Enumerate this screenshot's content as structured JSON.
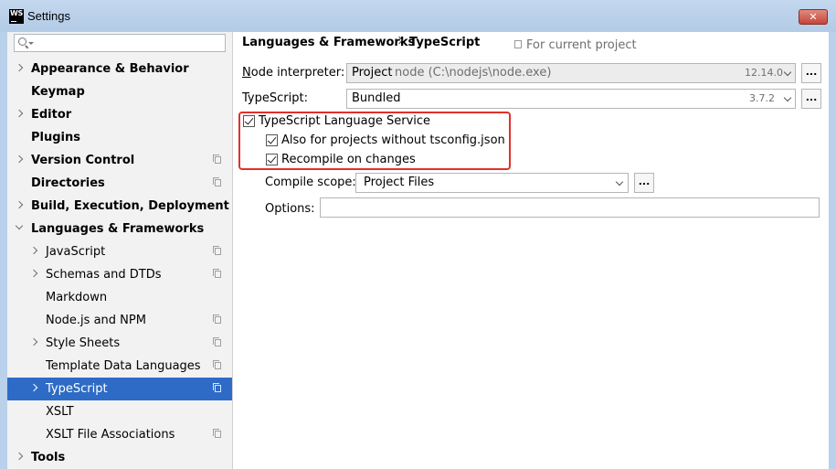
{
  "window": {
    "title": "Settings",
    "app_badge": "WS",
    "close_glyph": "✕"
  },
  "sidebar": {
    "search_placeholder": "",
    "items": [
      {
        "label": "Appearance & Behavior",
        "bold": true,
        "expander": "collapsed",
        "level": 0,
        "scope_icon": false
      },
      {
        "label": "Keymap",
        "bold": true,
        "expander": "none",
        "level": 0,
        "scope_icon": false
      },
      {
        "label": "Editor",
        "bold": true,
        "expander": "collapsed",
        "level": 0,
        "scope_icon": false
      },
      {
        "label": "Plugins",
        "bold": true,
        "expander": "none",
        "level": 0,
        "scope_icon": false
      },
      {
        "label": "Version Control",
        "bold": true,
        "expander": "collapsed",
        "level": 0,
        "scope_icon": true
      },
      {
        "label": "Directories",
        "bold": true,
        "expander": "none",
        "level": 0,
        "scope_icon": true
      },
      {
        "label": "Build, Execution, Deployment",
        "bold": true,
        "expander": "collapsed",
        "level": 0,
        "scope_icon": false
      },
      {
        "label": "Languages & Frameworks",
        "bold": true,
        "expander": "expanded",
        "level": 0,
        "scope_icon": false
      },
      {
        "label": "JavaScript",
        "bold": false,
        "expander": "collapsed",
        "level": 1,
        "scope_icon": true
      },
      {
        "label": "Schemas and DTDs",
        "bold": false,
        "expander": "collapsed",
        "level": 1,
        "scope_icon": true
      },
      {
        "label": "Markdown",
        "bold": false,
        "expander": "none",
        "level": 1,
        "scope_icon": false
      },
      {
        "label": "Node.js and NPM",
        "bold": false,
        "expander": "none",
        "level": 1,
        "scope_icon": true
      },
      {
        "label": "Style Sheets",
        "bold": false,
        "expander": "collapsed",
        "level": 1,
        "scope_icon": true
      },
      {
        "label": "Template Data Languages",
        "bold": false,
        "expander": "none",
        "level": 1,
        "scope_icon": true
      },
      {
        "label": "TypeScript",
        "bold": false,
        "expander": "collapsed",
        "level": 1,
        "scope_icon": true,
        "selected": true
      },
      {
        "label": "XSLT",
        "bold": false,
        "expander": "none",
        "level": 1,
        "scope_icon": false
      },
      {
        "label": "XSLT File Associations",
        "bold": false,
        "expander": "none",
        "level": 1,
        "scope_icon": true
      },
      {
        "label": "Tools",
        "bold": true,
        "expander": "collapsed",
        "level": 0,
        "scope_icon": false
      }
    ]
  },
  "breadcrumb": {
    "parent": "Languages & Frameworks",
    "current": "TypeScript",
    "scope_note": "For current project"
  },
  "node_interpreter": {
    "label": "Node interpreter:",
    "mnemonic": "N",
    "label_rest": "ode interpreter:",
    "kind": "Project",
    "path": "node (C:\\nodejs\\node.exe)",
    "version": "12.14.0",
    "browse": "..."
  },
  "typescript": {
    "label": "TypeScript:",
    "value": "Bundled",
    "version": "3.7.2",
    "browse": "..."
  },
  "language_service": {
    "label": "TypeScript Language Service",
    "checked": true,
    "without_tsconfig": {
      "label": "Also for projects without tsconfig.json",
      "checked": true
    },
    "recompile": {
      "label": "Recompile on changes",
      "checked": true
    }
  },
  "compile_scope": {
    "label": "Compile scope:",
    "value": "Project Files",
    "browse": "..."
  },
  "options": {
    "label": "Options:",
    "value": ""
  },
  "colors": {
    "selection": "#2d6bc6",
    "highlight_border": "#e0312b",
    "title_bar": "#b9d1ea"
  }
}
